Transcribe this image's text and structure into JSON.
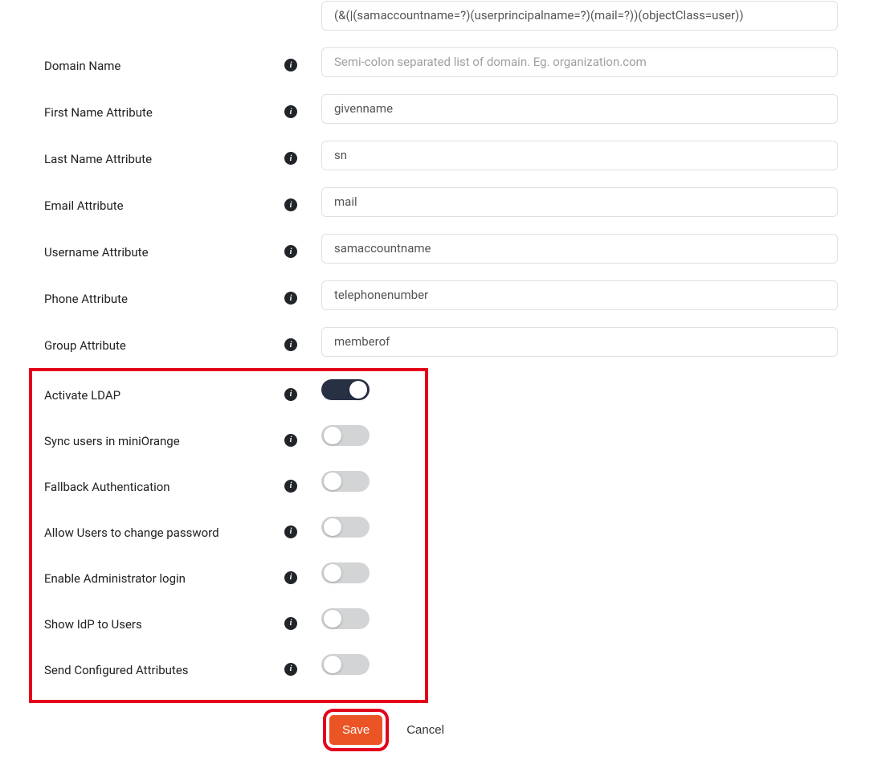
{
  "fields": {
    "filter": {
      "value": "(&(|(samaccountname=?)(userprincipalname=?)(mail=?))(objectClass=user))"
    },
    "domain_name": {
      "label": "Domain Name",
      "placeholder": "Semi-colon separated list of domain. Eg. organization.com",
      "value": ""
    },
    "first_name": {
      "label": "First Name Attribute",
      "value": "givenname"
    },
    "last_name": {
      "label": "Last Name Attribute",
      "value": "sn"
    },
    "email": {
      "label": "Email Attribute",
      "value": "mail"
    },
    "username": {
      "label": "Username Attribute",
      "value": "samaccountname"
    },
    "phone": {
      "label": "Phone Attribute",
      "value": "telephonenumber"
    },
    "group": {
      "label": "Group Attribute",
      "value": "memberof"
    }
  },
  "toggles": {
    "activate_ldap": {
      "label": "Activate LDAP",
      "on": true
    },
    "sync_users": {
      "label": "Sync users in miniOrange",
      "on": false
    },
    "fallback_auth": {
      "label": "Fallback Authentication",
      "on": false
    },
    "allow_change_pw": {
      "label": "Allow Users to change password",
      "on": false
    },
    "enable_admin": {
      "label": "Enable Administrator login",
      "on": false
    },
    "show_idp": {
      "label": "Show IdP to Users",
      "on": false
    },
    "send_attrs": {
      "label": "Send Configured Attributes",
      "on": false
    }
  },
  "actions": {
    "save": "Save",
    "cancel": "Cancel"
  }
}
